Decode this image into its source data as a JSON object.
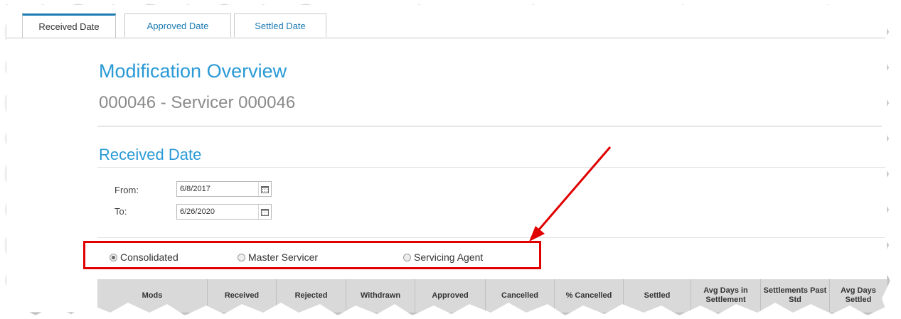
{
  "tabs": [
    {
      "label": "Received Date",
      "active": true
    },
    {
      "label": "Approved Date",
      "active": false
    },
    {
      "label": "Settled Date",
      "active": false
    }
  ],
  "page": {
    "title": "Modification Overview",
    "subtitle": "000046 - Servicer 000046",
    "section_title": "Received Date"
  },
  "filters": {
    "from_label": "From:",
    "from_value": "6/8/2017",
    "to_label": "To:",
    "to_value": "6/26/2020"
  },
  "view_options": [
    {
      "label": "Consolidated",
      "checked": true
    },
    {
      "label": "Master Servicer",
      "checked": false
    },
    {
      "label": "Servicing Agent",
      "checked": false
    }
  ],
  "table": {
    "columns": [
      "Mods",
      "Received",
      "Rejected",
      "Withdrawn",
      "Approved",
      "Cancelled",
      "% Cancelled",
      "Settled",
      "Avg Days in Settlement",
      "Settlements Past Std",
      "Avg Days Settled"
    ]
  },
  "annotation": {
    "color": "#e00000"
  }
}
